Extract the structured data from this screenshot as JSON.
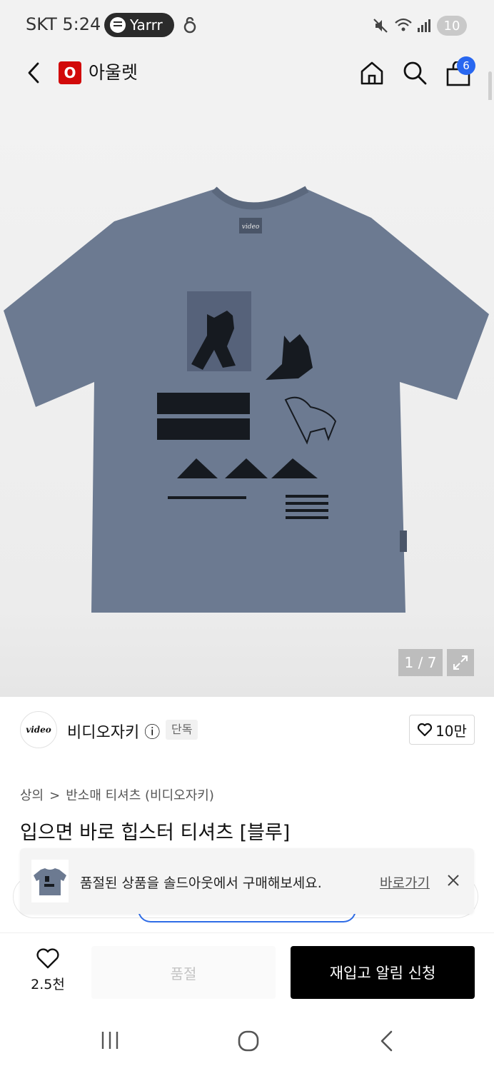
{
  "status_bar": {
    "carrier_time": "SKT 5:24",
    "spotify_label": "Yarrr",
    "battery": "10"
  },
  "header": {
    "logo_letter": "O",
    "logo_text": "아울렛",
    "cart_count": "6"
  },
  "hero": {
    "counter": "1 / 7",
    "print_label": "video"
  },
  "brand": {
    "logo_text": "video",
    "name": "비디오자키",
    "info_symbol": "ⓘ",
    "tag": "단독",
    "likes": "10만"
  },
  "breadcrumb": {
    "level1": "상의",
    "separator": ">",
    "level2": "반소매 티셔츠 (비디오자키)"
  },
  "product": {
    "title": "입으면 바로 힙스터 티셔츠 [블루]"
  },
  "toast": {
    "message": "품절된 상품을 솔드아웃에서 구매해보세요.",
    "link": "바로가기"
  },
  "bottom_bar": {
    "wish_count": "2.5천",
    "soldout_label": "품절",
    "restock_label": "재입고 알림 신청"
  },
  "colors": {
    "accent_red": "#d20a0a",
    "badge_blue": "#2867f0",
    "shirt": "#6c7a91",
    "cta_black": "#000000"
  }
}
